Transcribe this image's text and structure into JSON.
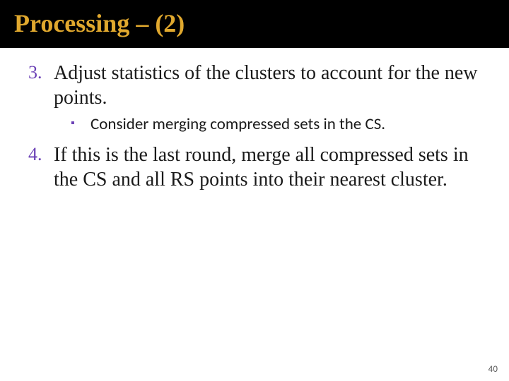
{
  "title": "Processing – (2)",
  "items": {
    "n3": {
      "num": "3.",
      "text": "Adjust statistics of the clusters to account for the new points."
    },
    "sub": {
      "bullet": "▪",
      "text": "Consider merging compressed sets in the CS."
    },
    "n4": {
      "num": "4.",
      "text": "If this is the last round, merge all compressed sets in the CS and all RS points into their nearest cluster."
    }
  },
  "page": "40"
}
